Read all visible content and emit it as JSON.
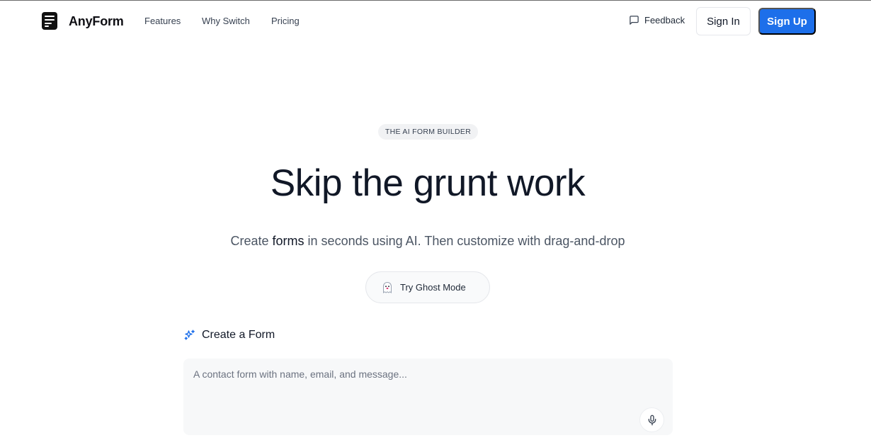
{
  "brand": {
    "name": "AnyForm",
    "logo_icon": "form-document-icon"
  },
  "nav": {
    "links": [
      "Features",
      "Why Switch",
      "Pricing"
    ],
    "feedback_label": "Feedback",
    "sign_in_label": "Sign In",
    "sign_up_label": "Sign Up"
  },
  "hero": {
    "badge": "THE AI FORM BUILDER",
    "title": "Skip the grunt work",
    "subtitle_before": "Create ",
    "subtitle_emphasis": "forms",
    "subtitle_after": " in seconds using AI. Then customize with drag-and-drop",
    "ghost_button_label": "Try Ghost Mode"
  },
  "create_form": {
    "label": "Create a Form",
    "placeholder": "A contact form with name, email, and message..."
  },
  "colors": {
    "accent": "#1d6fea",
    "text": "#111827",
    "muted": "#4b5563"
  }
}
